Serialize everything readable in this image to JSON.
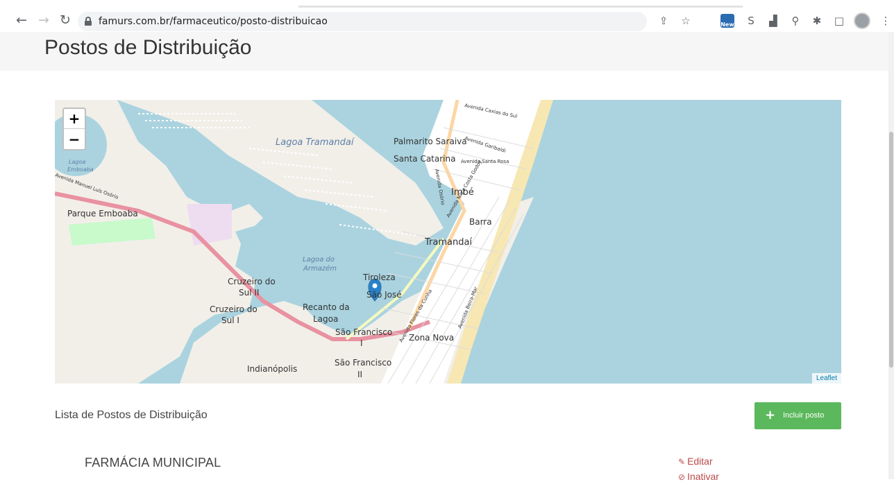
{
  "browser": {
    "url": "famurs.com.br/farmaceutico/posto-distribuicao",
    "new_badge": "New"
  },
  "page": {
    "title": "Postos de Distribuição"
  },
  "map": {
    "zoom_in": "+",
    "zoom_out": "−",
    "attribution": "Leaflet",
    "labels": {
      "lagoa_tramandai": "Lagoa Tramandaí",
      "palmarito": "Palmarito Saraiva",
      "santa_catarina": "Santa Catarina",
      "imbe": "Imbé",
      "barra": "Barra",
      "tramandai": "Tramandaí",
      "tiroleza": "Tiroleza",
      "sao_jose": "São José",
      "recanto1": "Recanto da",
      "recanto2": "Lagoa",
      "sao_francisco1_a": "São Francisco",
      "sao_francisco1_b": "I",
      "zona_nova": "Zona Nova",
      "sao_francisco2_a": "São Francisco",
      "sao_francisco2_b": "II",
      "indianopolis": "Indianópolis",
      "cruzeiro2_a": "Cruzeiro do",
      "cruzeiro2_b": "Sul II",
      "cruzeiro1_a": "Cruzeiro do",
      "cruzeiro1_b": "Sul I",
      "parque_emboaba": "Parque Emboaba",
      "lagoa_emboaba_a": "Lagoa",
      "lagoa_emboaba_b": "Emboaba",
      "lagoa_armazem_a": "Lagoa do",
      "lagoa_armazem_b": "Armazém",
      "av_caxias": "Avenida Caxias do Sul",
      "av_garibaldi": "Avenida Garibaldi",
      "av_santa_rosa": "Avenida Santa Rosa",
      "av_osorio": "Avenida Osório",
      "av_nilza": "Avenida Nilza Costa Godoy",
      "av_manuel": "Avenida Manuel Luís Osório",
      "av_flores": "Avenida Flores da Cunha",
      "av_beira_mar": "Avenida Beira-Mar"
    }
  },
  "list": {
    "title": "Lista de Postos de Distribuição",
    "add_button": "Incluir posto",
    "rows": [
      {
        "name": "FARMÁCIA MUNICIPAL",
        "edit": "Editar",
        "deactivate": "Inativar"
      }
    ]
  }
}
